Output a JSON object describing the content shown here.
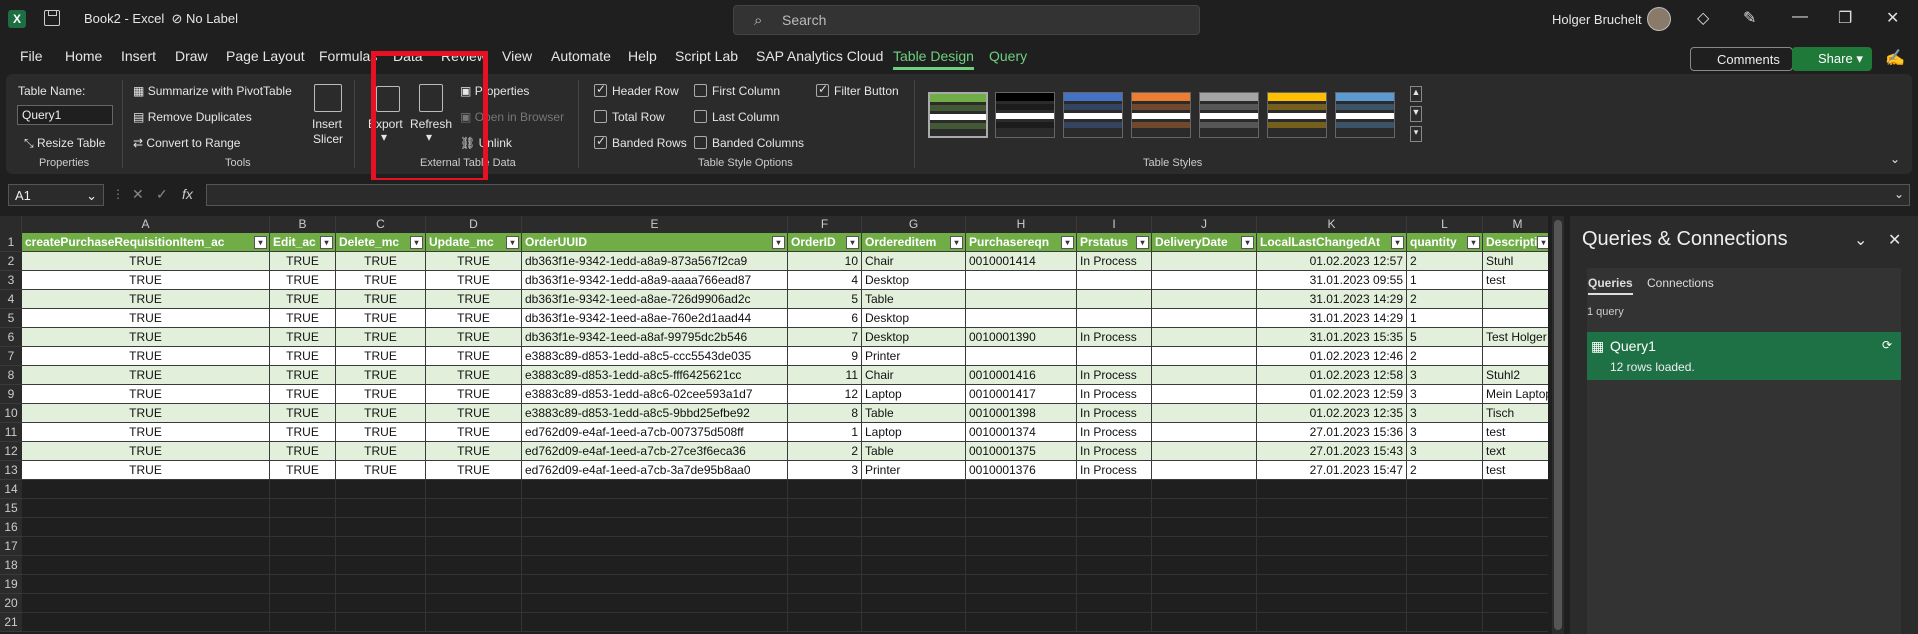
{
  "window": {
    "app_icon": "excel-icon",
    "doc_title": "Book2 - Excel",
    "label": "No Label",
    "search_placeholder": "Search",
    "user_name": "Holger Bruchelt"
  },
  "menu": [
    "File",
    "Home",
    "Insert",
    "Draw",
    "Page Layout",
    "Formulas",
    "Data",
    "Review",
    "View",
    "Automate",
    "Help",
    "Script Lab",
    "SAP Analytics Cloud",
    "Table Design",
    "Query"
  ],
  "actions": {
    "comments": "Comments",
    "share": "Share"
  },
  "ribbon": {
    "properties": {
      "table_name_label": "Table Name:",
      "table_name_value": "Query1",
      "resize": "Resize Table",
      "group": "Properties"
    },
    "tools": {
      "pivot": "Summarize with PivotTable",
      "dupes": "Remove Duplicates",
      "convert": "Convert to Range",
      "slicer1": "Insert",
      "slicer2": "Slicer",
      "group": "Tools"
    },
    "external": {
      "export": "Export",
      "refresh": "Refresh",
      "properties": "Properties",
      "open_browser": "Open in Browser",
      "unlink": "Unlink",
      "group": "External Table Data"
    },
    "style_options": {
      "header_row": "Header Row",
      "total_row": "Total Row",
      "banded_rows": "Banded Rows",
      "first_column": "First Column",
      "last_column": "Last Column",
      "banded_columns": "Banded Columns",
      "filter_button": "Filter Button",
      "group": "Table Style Options"
    },
    "styles": {
      "group": "Table Styles",
      "colors": [
        "#70ad47",
        "#000000",
        "#4472c4",
        "#ed7d31",
        "#a5a5a5",
        "#ffc000",
        "#5b9bd5"
      ]
    }
  },
  "formula_bar": {
    "name_box": "A1",
    "fx": "fx",
    "value": ""
  },
  "sheet": {
    "col_letters": [
      "A",
      "B",
      "C",
      "D",
      "E",
      "F",
      "G",
      "H",
      "I",
      "J",
      "K",
      "L",
      "M"
    ],
    "headers": [
      "createPurchaseRequisitionItem_ac",
      "Edit_ac",
      "Delete_mc",
      "Update_mc",
      "OrderUUID",
      "OrderID",
      "Ordereditem",
      "Purchasereqn",
      "Prstatus",
      "DeliveryDate",
      "LocalLastChangedAt",
      "quantity",
      "Description"
    ],
    "rows": [
      [
        "TRUE",
        "TRUE",
        "TRUE",
        "TRUE",
        "db363f1e-9342-1edd-a8a9-873a567f2ca9",
        "10",
        "Chair",
        "0010001414",
        "In Process",
        "",
        "01.02.2023 12:57",
        "2",
        "Stuhl"
      ],
      [
        "TRUE",
        "TRUE",
        "TRUE",
        "TRUE",
        "db363f1e-9342-1edd-a8a9-aaaa766ead87",
        "4",
        "Desktop",
        "",
        "",
        "",
        "31.01.2023 09:55",
        "1",
        "test"
      ],
      [
        "TRUE",
        "TRUE",
        "TRUE",
        "TRUE",
        "db363f1e-9342-1eed-a8ae-726d9906ad2c",
        "5",
        "Table",
        "",
        "",
        "",
        "31.01.2023 14:29",
        "2",
        ""
      ],
      [
        "TRUE",
        "TRUE",
        "TRUE",
        "TRUE",
        "db363f1e-9342-1eed-a8ae-760e2d1aad44",
        "6",
        "Desktop",
        "",
        "",
        "",
        "31.01.2023 14:29",
        "1",
        ""
      ],
      [
        "TRUE",
        "TRUE",
        "TRUE",
        "TRUE",
        "db363f1e-9342-1eed-a8af-99795dc2b546",
        "7",
        "Desktop",
        "0010001390",
        "In Process",
        "",
        "31.01.2023 15:35",
        "5",
        "Test Holger"
      ],
      [
        "TRUE",
        "TRUE",
        "TRUE",
        "TRUE",
        "e3883c89-d853-1edd-a8c5-ccc5543de035",
        "9",
        "Printer",
        "",
        "",
        "",
        "01.02.2023 12:46",
        "2",
        ""
      ],
      [
        "TRUE",
        "TRUE",
        "TRUE",
        "TRUE",
        "e3883c89-d853-1edd-a8c5-fff6425621cc",
        "11",
        "Chair",
        "0010001416",
        "In Process",
        "",
        "01.02.2023 12:58",
        "3",
        "Stuhl2"
      ],
      [
        "TRUE",
        "TRUE",
        "TRUE",
        "TRUE",
        "e3883c89-d853-1edd-a8c6-02cee593a1d7",
        "12",
        "Laptop",
        "0010001417",
        "In Process",
        "",
        "01.02.2023 12:59",
        "3",
        "Mein Laptop"
      ],
      [
        "TRUE",
        "TRUE",
        "TRUE",
        "TRUE",
        "e3883c89-d853-1edd-a8c5-9bbd25efbe92",
        "8",
        "Table",
        "0010001398",
        "In Process",
        "",
        "01.02.2023 12:35",
        "3",
        "Tisch"
      ],
      [
        "TRUE",
        "TRUE",
        "TRUE",
        "TRUE",
        "ed762d09-e4af-1eed-a7cb-007375d508ff",
        "1",
        "Laptop",
        "0010001374",
        "In Process",
        "",
        "27.01.2023 15:36",
        "3",
        "test"
      ],
      [
        "TRUE",
        "TRUE",
        "TRUE",
        "TRUE",
        "ed762d09-e4af-1eed-a7cb-27ce3f6eca36",
        "2",
        "Table",
        "0010001375",
        "In Process",
        "",
        "27.01.2023 15:43",
        "3",
        "text"
      ],
      [
        "TRUE",
        "TRUE",
        "TRUE",
        "TRUE",
        "ed762d09-e4af-1eed-a7cb-3a7de95b8aa0",
        "3",
        "Printer",
        "0010001376",
        "In Process",
        "",
        "27.01.2023 15:47",
        "2",
        "test"
      ]
    ],
    "row_numbers": [
      "1",
      "2",
      "3",
      "4",
      "5",
      "6",
      "7",
      "8",
      "9",
      "10",
      "11",
      "12",
      "13",
      "14",
      "15",
      "16",
      "17",
      "18",
      "19",
      "20",
      "21"
    ]
  },
  "queries_panel": {
    "title": "Queries & Connections",
    "tab_queries": "Queries",
    "tab_connections": "Connections",
    "count": "1 query",
    "item_name": "Query1",
    "item_status": "12 rows loaded."
  }
}
